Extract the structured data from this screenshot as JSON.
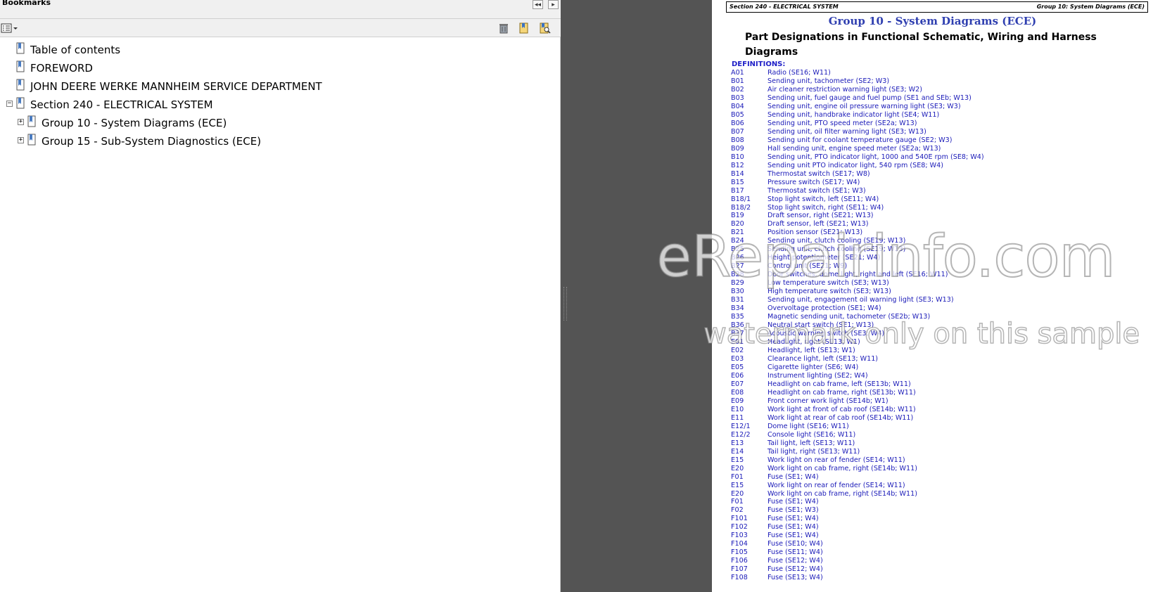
{
  "bookmarks_panel": {
    "title": "Bookmarks",
    "items": [
      {
        "label": "Table of contents"
      },
      {
        "label": "FOREWORD"
      },
      {
        "label": "JOHN DEERE WERKE MANNHEIM SERVICE DEPARTMENT"
      },
      {
        "label": "Section 240 - ELECTRICAL SYSTEM"
      },
      {
        "label": "Group 10 - System Diagrams (ECE)"
      },
      {
        "label": "Group 15 - Sub-System Diagnostics (ECE)"
      }
    ],
    "expander_expanded": "−",
    "expander_collapsed": "+"
  },
  "page": {
    "header_left": "Section 240 - ELECTRICAL SYSTEM",
    "header_right": "Group 10: System Diagrams (ECE)",
    "group_title": "Group 10 - System Diagrams (ECE)",
    "part_title": "Part Designations in Functional Schematic, Wiring and Harness Diagrams",
    "definitions_label": "DEFINITIONS:",
    "definitions": [
      {
        "code": "A01",
        "desc": "Radio (SE16; W11)"
      },
      {
        "code": "B01",
        "desc": "Sending unit, tachometer (SE2; W3)"
      },
      {
        "code": "B02",
        "desc": "Air cleaner restriction warning light (SE3; W2)"
      },
      {
        "code": "B03",
        "desc": "Sending unit, fuel gauge and fuel pump (SE1 and SEb; W13)"
      },
      {
        "code": "B04",
        "desc": "Sending unit, engine oil pressure warning light (SE3; W3)"
      },
      {
        "code": "B05",
        "desc": "Sending unit, handbrake indicator light (SE4; W11)"
      },
      {
        "code": "B06",
        "desc": "Sending unit, PTO speed meter (SE2a; W13)"
      },
      {
        "code": "B07",
        "desc": "Sending unit, oil filter warning light (SE3; W13)"
      },
      {
        "code": "B08",
        "desc": "Sending unit for coolant temperature gauge (SE2; W3)"
      },
      {
        "code": "B09",
        "desc": "Hall sending unit, engine speed meter (SE2a; W13)"
      },
      {
        "code": "B10",
        "desc": "Sending unit, PTO indicator light, 1000 and 540E rpm (SE8; W4)"
      },
      {
        "code": "B12",
        "desc": "Sending unit PTO indicator light, 540 rpm (SE8; W4)"
      },
      {
        "code": "B14",
        "desc": "Thermostat switch (SE17; W8)"
      },
      {
        "code": "B15",
        "desc": "Pressure switch (SE17; W4)"
      },
      {
        "code": "B17",
        "desc": "Thermostat switch (SE1; W3)"
      },
      {
        "code": "B18/1",
        "desc": "Stop light switch, left (SE11; W4)"
      },
      {
        "code": "B18/2",
        "desc": "Stop light switch, right (SE11; W4)"
      },
      {
        "code": "B19",
        "desc": "Draft sensor, right (SE21; W13)"
      },
      {
        "code": "B20",
        "desc": "Draft sensor, left (SE21; W13)"
      },
      {
        "code": "B21",
        "desc": "Position sensor (SE21; W13)"
      },
      {
        "code": "B24",
        "desc": "Sending unit, clutch cooling (SE19; W13)"
      },
      {
        "code": "B25",
        "desc": "Sending unit, clutch cooling (SE19; W13)"
      },
      {
        "code": "B26",
        "desc": "Height potentiometer (SE21; W4)"
      },
      {
        "code": "B27",
        "desc": "Control unit (SE21; W9)"
      },
      {
        "code": "B28",
        "desc": "Door switches, dome light, right and left (SE16; W11)"
      },
      {
        "code": "B29",
        "desc": "Low temperature switch (SE3; W13)"
      },
      {
        "code": "B30",
        "desc": "High temperature switch (SE3; W13)"
      },
      {
        "code": "B31",
        "desc": "Sending unit, engagement oil warning light (SE3; W13)"
      },
      {
        "code": "B34",
        "desc": "Overvoltage protection (SE1; W4)"
      },
      {
        "code": "B35",
        "desc": "Magnetic sending unit, tachometer (SE2b; W13)"
      },
      {
        "code": "B36",
        "desc": "Neutral start switch (SE1; W13)"
      },
      {
        "code": "B37",
        "desc": "Acoustic warning switch (SE3; W4)"
      },
      {
        "code": "E01",
        "desc": "Headlight, right (SE13; W1)"
      },
      {
        "code": "E02",
        "desc": "Headlight, left (SE13; W1)"
      },
      {
        "code": "E03",
        "desc": "Clearance light, left (SE13; W11)"
      },
      {
        "code": "E05",
        "desc": "Cigarette lighter (SE6; W4)"
      },
      {
        "code": "E06",
        "desc": "Instrument lighting (SE2; W4)"
      },
      {
        "code": "E07",
        "desc": "Headlight on cab frame, left (SE13b; W11)"
      },
      {
        "code": "E08",
        "desc": "Headlight on cab frame, right (SE13b; W11)"
      },
      {
        "code": "E09",
        "desc": "Front corner work light (SE14b; W1)"
      },
      {
        "code": "E10",
        "desc": "Work light at front of cab roof (SE14b; W11)"
      },
      {
        "code": "E11",
        "desc": "Work light at rear of cab roof (SE14b; W11)"
      },
      {
        "code": "E12/1",
        "desc": "Dome light (SE16; W11)"
      },
      {
        "code": "E12/2",
        "desc": "Console light (SE16; W11)"
      },
      {
        "code": "E13",
        "desc": "Tail light, left (SE13; W11)"
      },
      {
        "code": "E14",
        "desc": "Tail light, right (SE13; W11)"
      },
      {
        "code": "E15",
        "desc": "Work light on rear of fender (SE14; W11)"
      },
      {
        "code": "E20",
        "desc": "Work light on cab frame, right (SE14b; W11)"
      },
      {
        "code": "F01",
        "desc": "Fuse (SE1; W4)"
      },
      {
        "code": "E15",
        "desc": "Work light on rear of fender (SE14; W11)"
      },
      {
        "code": "E20",
        "desc": "Work light on cab frame, right (SE14b; W11)"
      },
      {
        "code": "F01",
        "desc": "Fuse (SE1; W4)"
      },
      {
        "code": "F02",
        "desc": "Fuse (SE1; W3)"
      },
      {
        "code": "F101",
        "desc": "Fuse (SE1; W4)"
      },
      {
        "code": "F102",
        "desc": "Fuse (SE1; W4)"
      },
      {
        "code": "F103",
        "desc": "Fuse (SE1; W4)"
      },
      {
        "code": "F104",
        "desc": "Fuse (SE10; W4)"
      },
      {
        "code": "F105",
        "desc": "Fuse (SE11; W4)"
      },
      {
        "code": "F106",
        "desc": "Fuse (SE12; W4)"
      },
      {
        "code": "F107",
        "desc": "Fuse (SE12; W4)"
      },
      {
        "code": "F108",
        "desc": "Fuse (SE13; W4)"
      }
    ]
  },
  "watermark": {
    "line1": "eRepairinfo.com",
    "line2": "watermark only on this sample"
  }
}
